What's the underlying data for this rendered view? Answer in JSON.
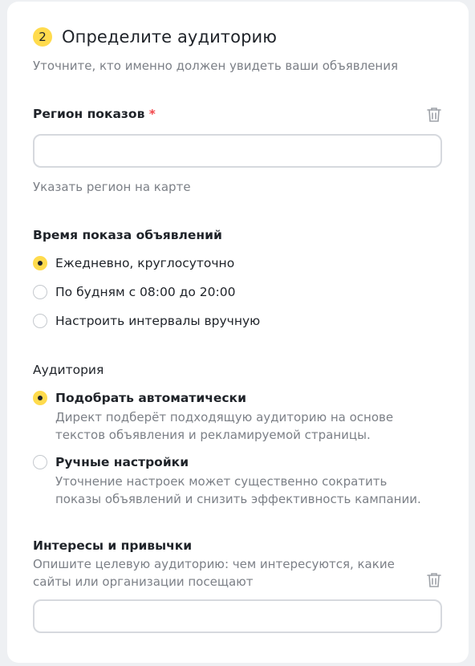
{
  "section": {
    "step_number": "2",
    "title": "Определите аудиторию",
    "subtitle": "Уточните, кто именно должен увидеть ваши объявления"
  },
  "region": {
    "label": "Регион показов",
    "required_mark": "*",
    "input_value": "",
    "map_link": "Указать регион на карте",
    "delete_icon": "trash-icon"
  },
  "schedule": {
    "label": "Время показа объявлений",
    "options": [
      {
        "label": "Ежедневно, круглосуточно",
        "checked": true
      },
      {
        "label": "По будням с 08:00 до 20:00",
        "checked": false
      },
      {
        "label": "Настроить интервалы вручную",
        "checked": false
      }
    ]
  },
  "audience": {
    "label": "Аудитория",
    "options": [
      {
        "label": "Подобрать автоматически",
        "desc_line1": "Директ подберёт подходящую аудиторию на основе",
        "desc_line2": "текстов объявления и рекламируемой страницы.",
        "checked": true
      },
      {
        "label": "Ручные настройки",
        "desc_line1": "Уточнение настроек может существенно сократить",
        "desc_line2": "показы объявлений и снизить эффективность кампании.",
        "checked": false
      }
    ]
  },
  "interests": {
    "label": "Интересы и привычки",
    "hint_line1": "Опишите целевую аудиторию: чем интересуются, какие",
    "hint_line2": "сайты или организации посещают",
    "input_value": "",
    "delete_icon": "trash-icon"
  },
  "colors": {
    "accent": "#ffdb4d",
    "required": "#f2464a",
    "muted_text": "#7c8087",
    "border": "#d6d9de"
  }
}
